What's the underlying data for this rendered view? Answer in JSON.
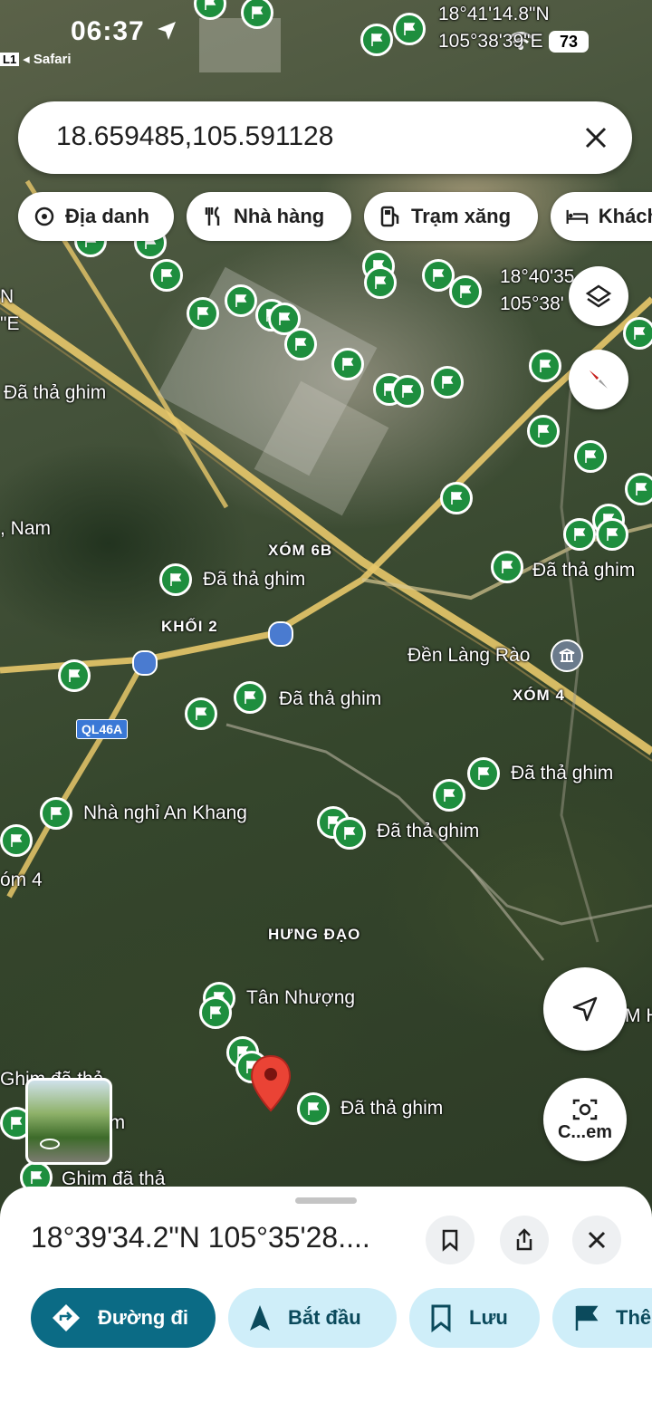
{
  "status_bar": {
    "time": "06:37",
    "back_badge": "L1",
    "back_label": "◂ Safari",
    "battery": "73"
  },
  "search": {
    "query": "18.659485,105.591128"
  },
  "chips": [
    {
      "label": "Địa danh",
      "icon": "landmark-icon"
    },
    {
      "label": "Nhà hàng",
      "icon": "restaurant-icon"
    },
    {
      "label": "Trạm xăng",
      "icon": "gas-station-icon"
    },
    {
      "label": "Khách",
      "icon": "hotel-icon"
    }
  ],
  "map": {
    "coord_label_1a": "18°41'14.8\"N",
    "coord_label_1b": "105°38'39\"E",
    "coord_label_2a": "18°40'35",
    "coord_label_2b": "105°38'",
    "left_edge_n": "N",
    "left_edge_e": "\"E",
    "pin_labels": {
      "dropped_1": "Đã thả ghim",
      "dropped_2": "Đã thả ghim",
      "dropped_3": "Đã thả ghim",
      "dropped_4": "Đã thả ghim",
      "dropped_5": "Đã thả ghim",
      "dropped_6": "Đã thả ghim",
      "dropped_7": "Đã thả ghim",
      "nha_nghi": "Nhà nghỉ An Khang",
      "tan_nhuong": "Tân Nhượng",
      "ghim_da_tha_1": "Ghim đã thả",
      "ghim_da_tha_2": "Ghim đã thả",
      "nam": ", Nam",
      "om4": "óm 4",
      "imm": "im",
      "mh": "M H"
    },
    "place_names": {
      "xom6b": "XÓM 6B",
      "khoi2": "KHỐI 2",
      "xom4": "XÓM 4",
      "hung_dao": "HƯNG ĐẠO",
      "den_lang_rao": "Đền Làng Rào",
      "route": "QL46A"
    }
  },
  "fabs": {
    "camera_label": "C...em"
  },
  "sheet": {
    "coords": "18°39'34.2\"N 105°35'28....",
    "actions": [
      {
        "label": "Đường đi"
      },
      {
        "label": "Bắt đầu"
      },
      {
        "label": "Lưu"
      },
      {
        "label": "Thê"
      }
    ]
  }
}
